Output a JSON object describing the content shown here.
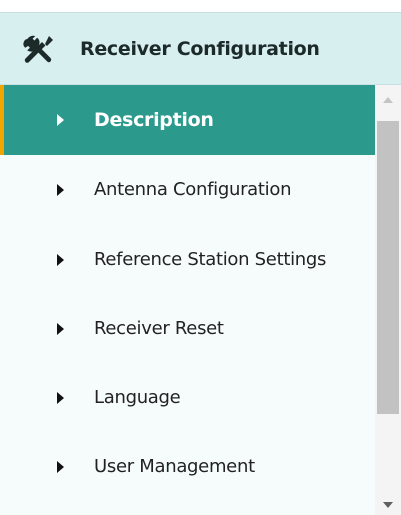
{
  "header": {
    "title": "Receiver Configuration",
    "icon": "tools-icon"
  },
  "menu": {
    "items": [
      {
        "label": "Description",
        "active": true
      },
      {
        "label": "Antenna Configuration",
        "active": false
      },
      {
        "label": "Reference Station Settings",
        "active": false
      },
      {
        "label": "Receiver Reset",
        "active": false
      },
      {
        "label": "Language",
        "active": false
      },
      {
        "label": "User Management",
        "active": false
      }
    ]
  },
  "colors": {
    "header_bg": "#d8eff0",
    "active_bg": "#2b9a8c",
    "active_accent": "#f0a500",
    "menu_bg": "#f6fcfc"
  }
}
